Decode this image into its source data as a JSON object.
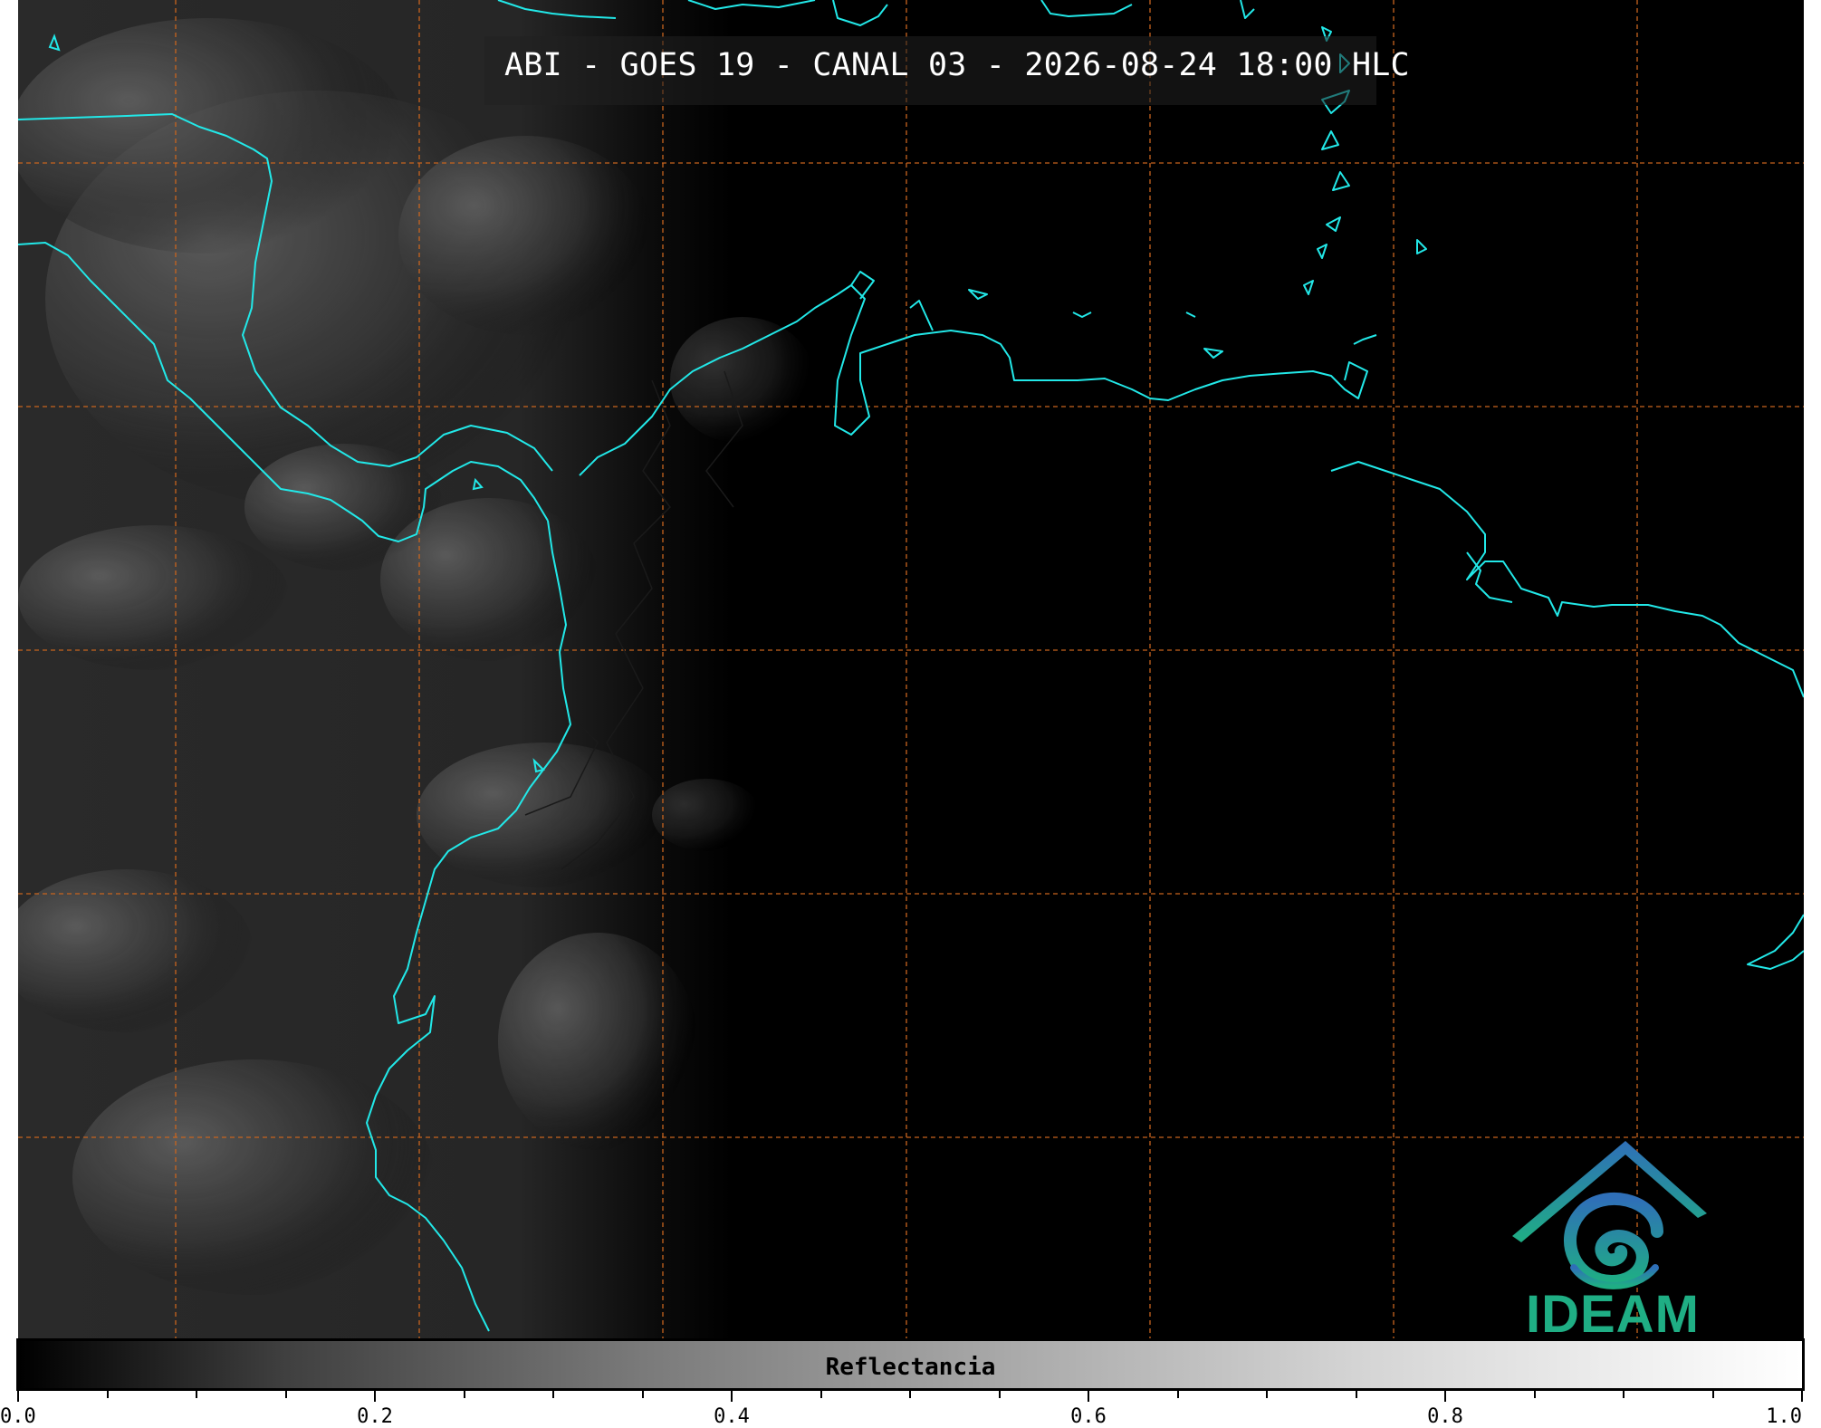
{
  "title": "ABI - GOES 19 - CANAL 03 - 2026-08-24 18:00 HLC",
  "logo_text": "IDEAM",
  "colorbar": {
    "label": "Reflectancia",
    "ticks": [
      "0.0",
      "0.2",
      "0.4",
      "0.6",
      "0.8",
      "1.0"
    ],
    "min": 0.0,
    "max": 1.0
  },
  "colors": {
    "coastline": "#22e8e8",
    "gridline": "#c8641e",
    "logo_text": "#1fae84",
    "logo_top": "#2f7fb8"
  }
}
